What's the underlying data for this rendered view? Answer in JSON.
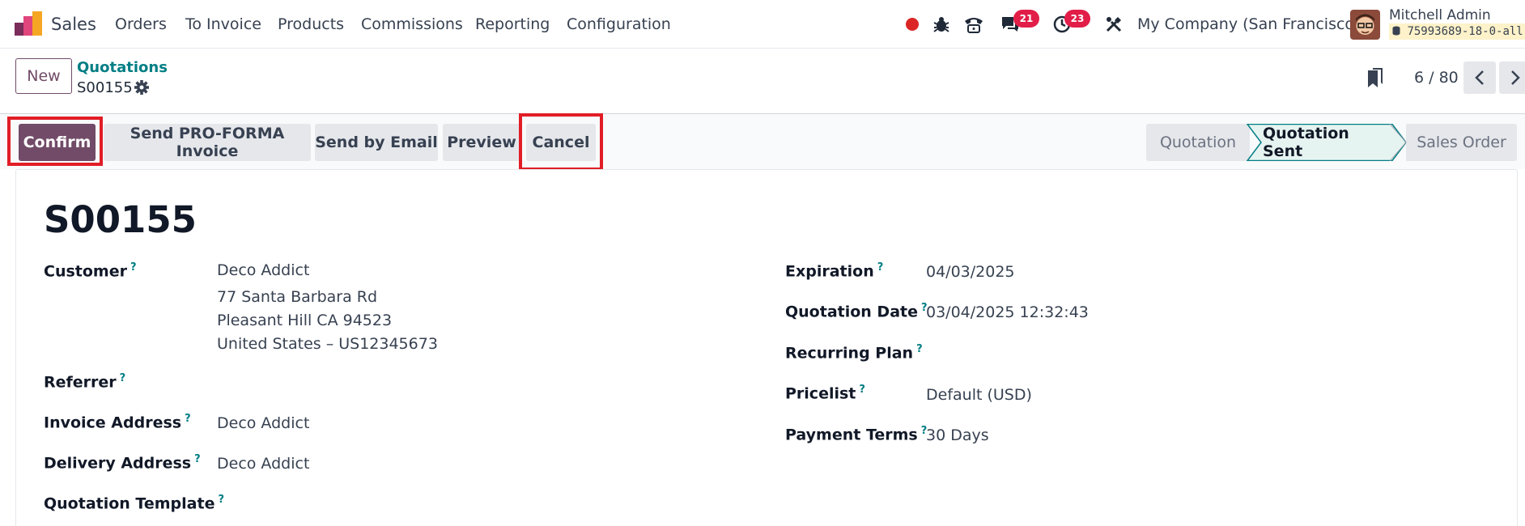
{
  "navbar": {
    "app_name": "Sales",
    "menu": [
      "Orders",
      "To Invoice",
      "Products",
      "Commissions",
      "Reporting",
      "Configuration"
    ],
    "messages_count": "21",
    "activities_count": "23",
    "company": "My Company (San Francisco)",
    "user_name": "Mitchell Admin",
    "database": "75993689-18-0-all"
  },
  "control_panel": {
    "new_label": "New",
    "breadcrumb": "Quotations",
    "record": "S00155",
    "pager": "6 / 80"
  },
  "actions": {
    "confirm": "Confirm",
    "proforma": "Send PRO-FORMA Invoice",
    "email": "Send by Email",
    "preview": "Preview",
    "cancel": "Cancel"
  },
  "statusbar": {
    "stages": [
      "Quotation",
      "Quotation Sent",
      "Sales Order"
    ],
    "current": "Quotation Sent"
  },
  "form": {
    "title": "S00155",
    "help": "?",
    "left": {
      "customer_label": "Customer",
      "customer_lines": [
        "Deco Addict",
        "77 Santa Barbara Rd",
        "Pleasant Hill CA 94523",
        "United States – US12345673"
      ],
      "referrer_label": "Referrer",
      "invoice_label": "Invoice Address",
      "invoice_value": "Deco Addict",
      "delivery_label": "Delivery Address",
      "delivery_value": "Deco Addict",
      "template_label": "Quotation Template"
    },
    "right": {
      "expiration_label": "Expiration",
      "expiration_value": "04/03/2025",
      "date_label": "Quotation Date",
      "date_value": "03/04/2025 12:32:43",
      "plan_label": "Recurring Plan",
      "pricelist_label": "Pricelist",
      "pricelist_value": "Default (USD)",
      "terms_label": "Payment Terms",
      "terms_value": "30 Days"
    }
  },
  "colors": {
    "brand": "#714b67",
    "link": "#017e84",
    "highlight": "#e11d26",
    "badge": "#e11d48"
  }
}
